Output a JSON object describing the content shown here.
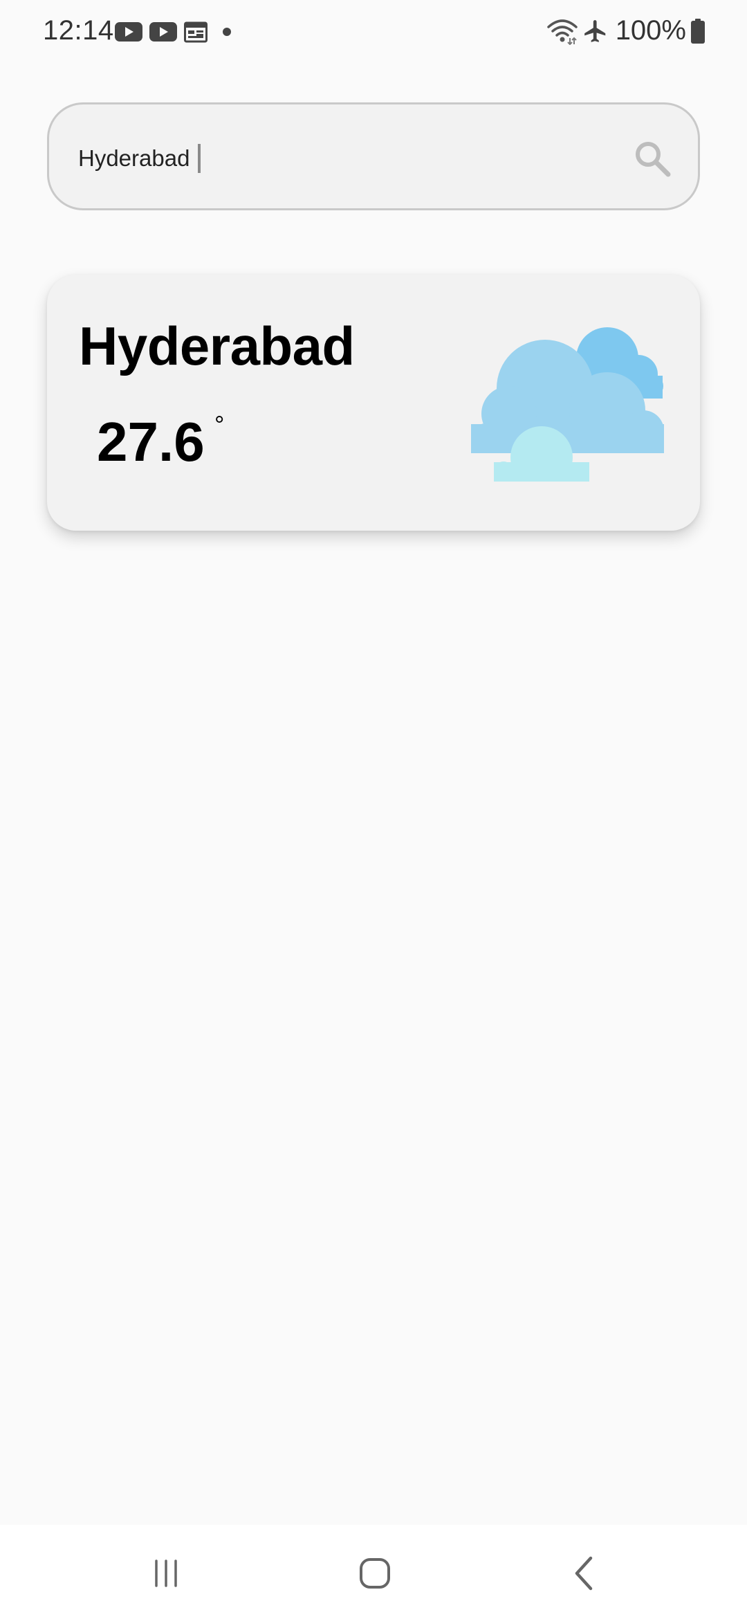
{
  "status_bar": {
    "time": "12:14",
    "battery": "100%",
    "left_icons": [
      "youtube-icon",
      "youtube-icon",
      "calendar-icon",
      "dot-icon"
    ],
    "right_icons": [
      "wifi-icon",
      "airplane-mode-icon",
      "battery-icon"
    ]
  },
  "search": {
    "value": "Hyderabad",
    "icon": "search-icon"
  },
  "weather_card": {
    "city": "Hyderabad",
    "temperature": "27.6",
    "degree": "°",
    "condition_icon": "cloudy-icon",
    "colors": {
      "cloud_back": "#7ec8ef",
      "cloud_front": "#9bd3ef",
      "cloud_small": "#b4eaf1"
    }
  },
  "nav_bar": {
    "buttons": [
      "recents-button",
      "home-button",
      "back-button"
    ]
  }
}
